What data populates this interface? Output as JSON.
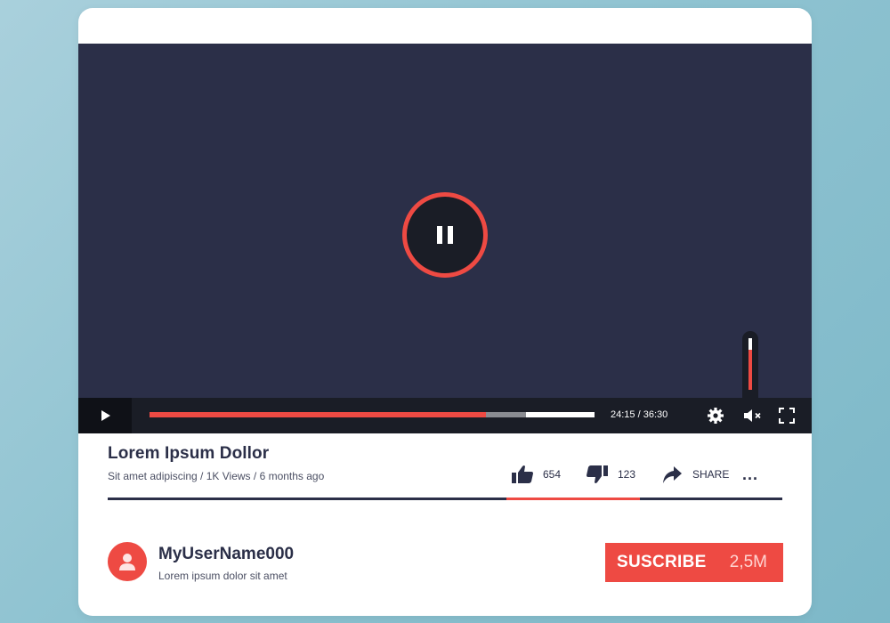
{
  "player": {
    "state": "paused",
    "current_time": "24:15",
    "separator": " / ",
    "duration": "36:30",
    "played_fraction": 0.755,
    "buffered_fraction": 0.845,
    "volume_fraction": 0.78,
    "muted": true,
    "accent_color": "#ee4a43"
  },
  "video": {
    "title": "Lorem Ipsum Dollor",
    "subtitle": "Sit amet adipiscing",
    "sep": " / ",
    "views": "1K Views",
    "age": "6 months ago"
  },
  "actions": {
    "likes": "654",
    "dislikes": "123",
    "share_label": "SHARE",
    "more_label": "..."
  },
  "channel": {
    "name": "MyUserName000",
    "description": "Lorem ipsum dolor sit amet",
    "subscribe_label": "SUSCRIBE",
    "subscriber_count": "2,5M"
  },
  "icons": {
    "play": "play-icon",
    "pause": "pause-icon",
    "settings": "gear-icon",
    "volume": "volume-muted-icon",
    "fullscreen": "fullscreen-icon",
    "like": "thumbs-up-icon",
    "dislike": "thumbs-down-icon",
    "share": "share-arrow-icon",
    "more": "more-dots-icon",
    "avatar": "user-icon"
  }
}
